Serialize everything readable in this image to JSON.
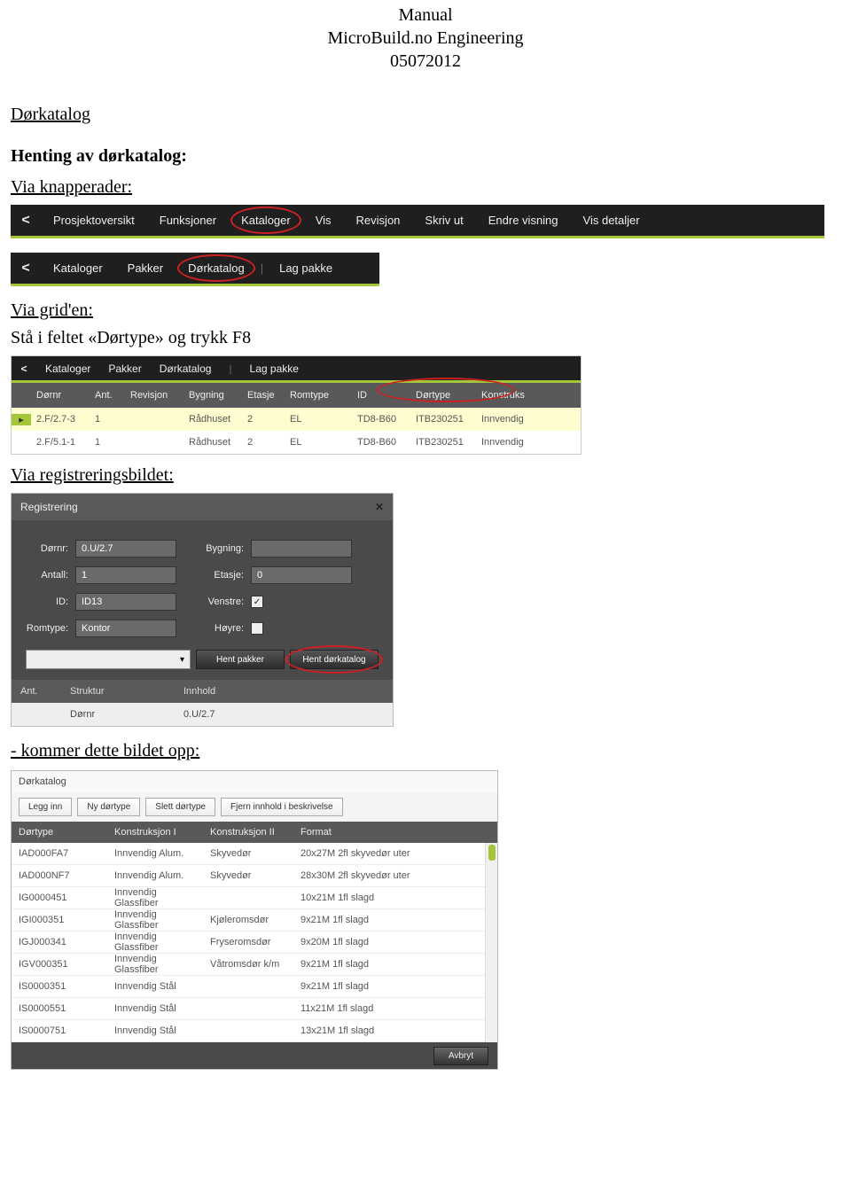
{
  "doc": {
    "title1": "Manual",
    "title2": "MicroBuild.no Engineering",
    "title3": "05072012"
  },
  "headings": {
    "dorkatalog": "Dørkatalog",
    "henting": "Henting av dørkatalog:",
    "via_knapperader": "Via knapperader:",
    "via_grid": "Via grid'en:",
    "grid_instr": "Stå i feltet «Dørtype» og trykk F8",
    "via_reg": "Via registreringsbildet:",
    "kommer": "- kommer dette bildet opp:"
  },
  "toolbar1": {
    "chev": "<",
    "items": [
      "Prosjektoversikt",
      "Funksjoner",
      "Kataloger",
      "Vis",
      "Revisjon",
      "Skriv ut",
      "Endre visning",
      "Vis detaljer"
    ],
    "circled_index": 2
  },
  "toolbar2": {
    "chev": "<",
    "items": [
      "Kataloger",
      "Pakker",
      "Dørkatalog",
      "|",
      "Lag pakke"
    ],
    "circled_index": 2
  },
  "grid": {
    "toolbar": {
      "chev": "<",
      "items": [
        "Kataloger",
        "Pakker",
        "Dørkatalog",
        "|",
        "Lag pakke"
      ]
    },
    "columns": [
      "",
      "Dørnr",
      "Ant.",
      "Revisjon",
      "Bygning",
      "Etasje",
      "Romtype",
      "ID",
      "Dørtype",
      "Konstruks"
    ],
    "rows": [
      {
        "sel": true,
        "cells": [
          "▸",
          "2.F/2.7-3",
          "1",
          "",
          "Rådhuset",
          "2",
          "EL",
          "TD8-B60",
          "ITB230251",
          "Innvendig"
        ]
      },
      {
        "sel": false,
        "cells": [
          "",
          "2.F/5.1-1",
          "1",
          "",
          "Rådhuset",
          "2",
          "EL",
          "TD8-B60",
          "ITB230251",
          "Innvendig"
        ]
      }
    ],
    "circled_col": 8
  },
  "reg": {
    "title": "Registrering",
    "fields": {
      "dornr_lab": "Dørnr:",
      "dornr_val": "0.U/2.7",
      "antall_lab": "Antall:",
      "antall_val": "1",
      "id_lab": "ID:",
      "id_val": "ID13",
      "romtype_lab": "Romtype:",
      "romtype_val": "Kontor",
      "bygning_lab": "Bygning:",
      "bygning_val": "",
      "etasje_lab": "Etasje:",
      "etasje_val": "0",
      "venstre_lab": "Venstre:",
      "venstre_checked": "✓",
      "hoyre_lab": "Høyre:"
    },
    "buttons": {
      "hent_pakker": "Hent pakker",
      "hent_dork": "Hent dørkatalog"
    },
    "subhead": {
      "ant": "Ant.",
      "struktur": "Struktur",
      "innhold": "Innhold"
    },
    "subrow": {
      "ant": "",
      "struktur": "Dørnr",
      "innhold": "0.U/2.7"
    }
  },
  "catalog": {
    "title": "Dørkatalog",
    "buttons": [
      "Legg inn",
      "Ny dørtype",
      "Slett dørtype",
      "Fjern innhold i beskrivelse"
    ],
    "columns": [
      "Dørtype",
      "Konstruksjon I",
      "Konstruksjon II",
      "Format"
    ],
    "rows": [
      [
        "IAD000FA7",
        "Innvendig Alum.",
        "Skyvedør",
        "20x27M 2fl skyvedør uter"
      ],
      [
        "IAD000NF7",
        "Innvendig Alum.",
        "Skyvedør",
        "28x30M 2fl skyvedør uter"
      ],
      [
        "IG0000451",
        "Innvendig Glassfiber",
        "",
        "10x21M 1fl slagd"
      ],
      [
        "IGI000351",
        "Innvendig Glassfiber",
        "Kjøleromsdør",
        "9x21M 1fl slagd"
      ],
      [
        "IGJ000341",
        "Innvendig Glassfiber",
        "Fryseromsdør",
        "9x20M 1fl slagd"
      ],
      [
        "IGV000351",
        "Innvendig Glassfiber",
        "Våtromsdør k/m",
        "9x21M 1fl slagd"
      ],
      [
        "IS0000351",
        "Innvendig Stål",
        "",
        "9x21M 1fl slagd"
      ],
      [
        "IS0000551",
        "Innvendig Stål",
        "",
        "11x21M 1fl slagd"
      ],
      [
        "IS0000751",
        "Innvendig Stål",
        "",
        "13x21M 1fl slagd"
      ]
    ],
    "footer_btn": "Avbryt"
  }
}
